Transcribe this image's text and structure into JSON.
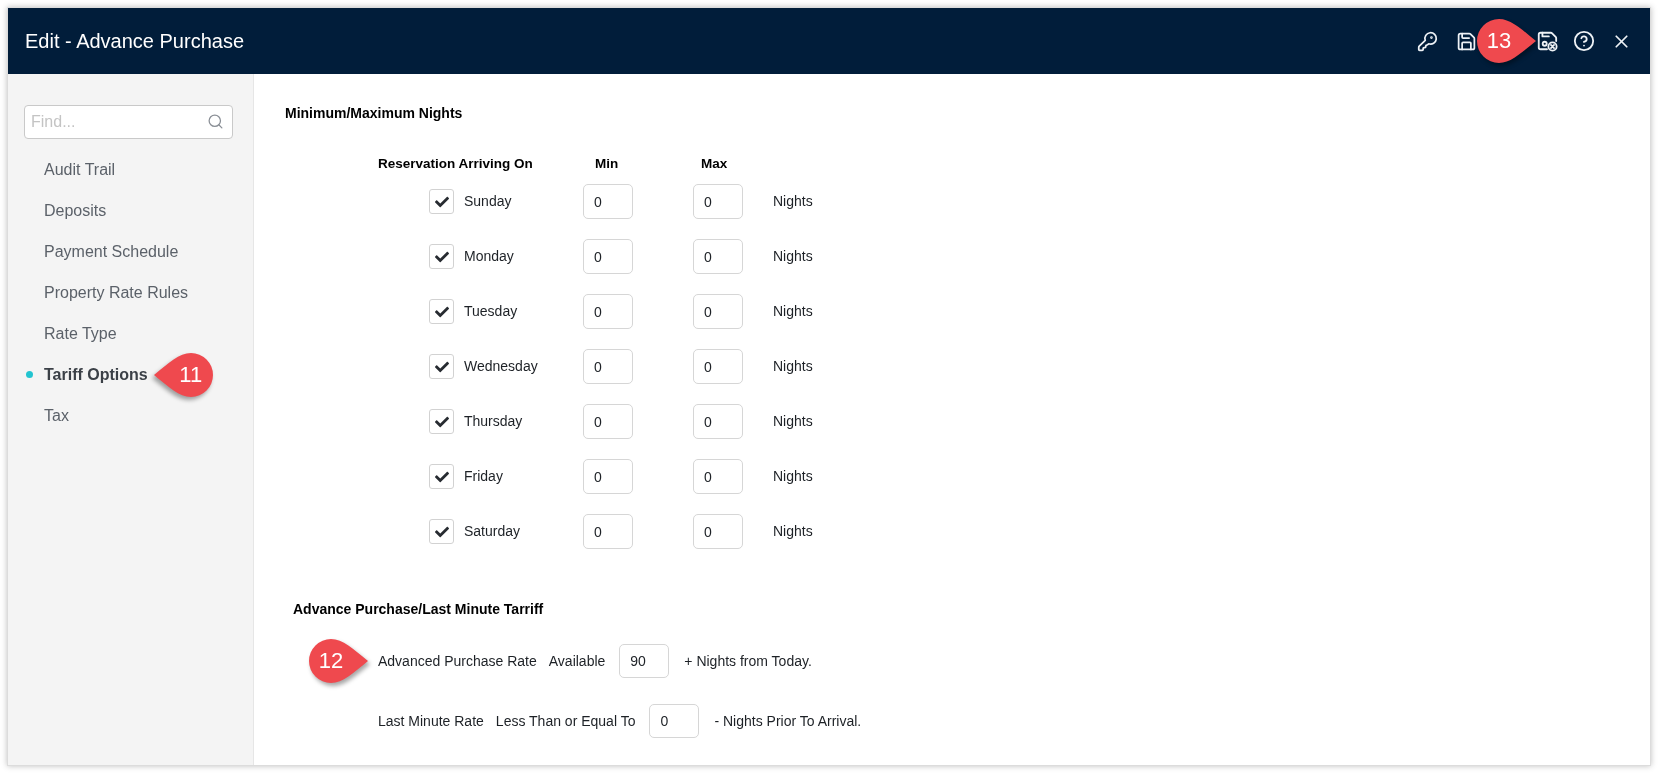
{
  "window": {
    "title": "Edit - Advance Purchase",
    "callout": "13"
  },
  "sidebar": {
    "search": {
      "placeholder": "Find..."
    },
    "items": [
      {
        "label": "Audit Trail",
        "selected": false
      },
      {
        "label": "Deposits",
        "selected": false
      },
      {
        "label": "Payment Schedule",
        "selected": false
      },
      {
        "label": "Property Rate Rules",
        "selected": false
      },
      {
        "label": "Rate Type",
        "selected": false
      },
      {
        "label": "Tariff Options",
        "selected": true,
        "callout": "11"
      },
      {
        "label": "Tax",
        "selected": false
      }
    ]
  },
  "min_max_nights": {
    "title": "Minimum/Maximum Nights",
    "columns": [
      "Reservation Arriving On",
      "Min",
      "Max"
    ],
    "rows": [
      {
        "day": "Sunday",
        "checked": true,
        "min": "0",
        "max": "0",
        "unit": "Nights"
      },
      {
        "day": "Monday",
        "checked": true,
        "min": "0",
        "max": "0",
        "unit": "Nights"
      },
      {
        "day": "Tuesday",
        "checked": true,
        "min": "0",
        "max": "0",
        "unit": "Nights"
      },
      {
        "day": "Wednesday",
        "checked": true,
        "min": "0",
        "max": "0",
        "unit": "Nights"
      },
      {
        "day": "Thursday",
        "checked": true,
        "min": "0",
        "max": "0",
        "unit": "Nights"
      },
      {
        "day": "Friday",
        "checked": true,
        "min": "0",
        "max": "0",
        "unit": "Nights"
      },
      {
        "day": "Saturday",
        "checked": true,
        "min": "0",
        "max": "0",
        "unit": "Nights"
      }
    ]
  },
  "advance_purchase": {
    "title": "Advance Purchase/Last Minute Tarriff",
    "rows": [
      {
        "label": "Advanced Purchase Rate",
        "qualifier": "Available",
        "value": "90",
        "suffix": "+ Nights from Today.",
        "callout": "12"
      },
      {
        "label": "Last Minute Rate",
        "qualifier": "Less Than or Equal To",
        "value": "0",
        "suffix": "- Nights Prior To Arrival."
      }
    ]
  }
}
